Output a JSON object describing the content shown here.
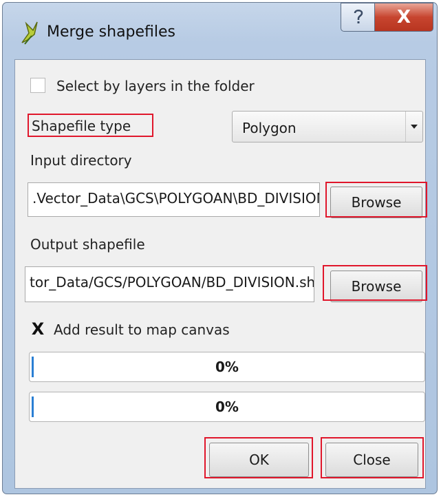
{
  "window": {
    "title": "Merge shapefiles",
    "icons": {
      "app": "merge-tool-icon",
      "help": "help-icon",
      "close": "close-icon"
    },
    "close_glyph": "X"
  },
  "form": {
    "select_by_layers": {
      "label": "Select by layers in the folder",
      "checked": false
    },
    "shapefile_type": {
      "label": "Shapefile type",
      "value": "Polygon"
    },
    "input_directory": {
      "label": "Input directory",
      "value": ".Vector_Data\\GCS\\POLYGOAN\\BD_DIVISION",
      "browse_label": "Browse"
    },
    "output_shapefile": {
      "label": "Output shapefile",
      "value": "tor_Data/GCS/POLYGOAN/BD_DIVISION.shp",
      "browse_label": "Browse"
    },
    "add_result": {
      "label": "Add result to map canvas",
      "checked": true,
      "mark": "X"
    },
    "progress": [
      {
        "value": 0,
        "text": "0%"
      },
      {
        "value": 0,
        "text": "0%"
      }
    ]
  },
  "buttons": {
    "ok": "OK",
    "close": "Close"
  },
  "colors": {
    "highlight": "#e0162b",
    "progress": "#2a7fd4",
    "close_button": "#c7452f"
  }
}
